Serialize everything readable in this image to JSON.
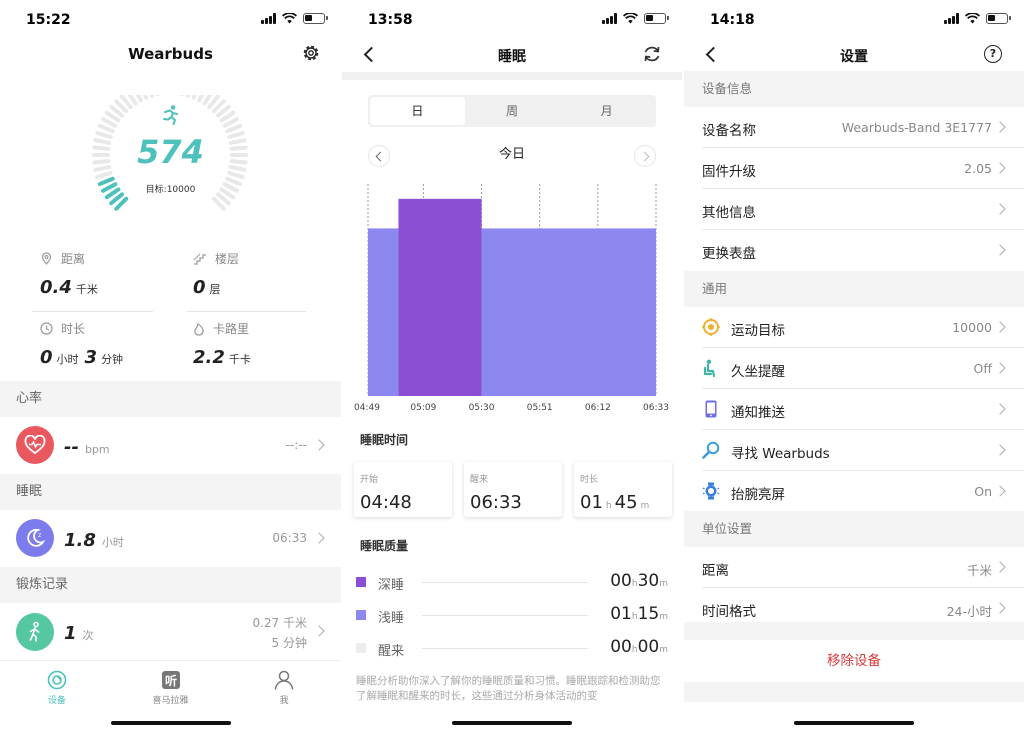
{
  "screen1": {
    "status_time": "15:22",
    "title": "Wearbuds",
    "steps": "574",
    "goal_text": "目标:10000",
    "stats": [
      {
        "icon": "location-pin-icon",
        "label": "距离",
        "value": "0.4",
        "unit": "千米"
      },
      {
        "icon": "stairs-icon",
        "label": "楼层",
        "value": "0",
        "unit": "层"
      },
      {
        "icon": "clock-icon",
        "label": "时长",
        "value1": "0",
        "unit1": "小时",
        "value2": "3",
        "unit2": "分钟"
      },
      {
        "icon": "flame-icon",
        "label": "卡路里",
        "value": "2.2",
        "unit": "千卡"
      }
    ],
    "heart": {
      "section": "心率",
      "value": "--",
      "unit": "bpm",
      "time": "--:--",
      "color": "#e8585e"
    },
    "sleep": {
      "section": "睡眠",
      "value": "1.8",
      "unit": "小时",
      "time": "06:33",
      "color": "#7d7ced"
    },
    "workout": {
      "section": "锻炼记录",
      "value": "1",
      "unit": "次",
      "distance": "0.27 千米",
      "duration": "5 分钟",
      "color": "#56c8a1"
    },
    "tabs": [
      {
        "label": "设备",
        "icon": "device-icon",
        "active": true
      },
      {
        "label": "喜马拉雅",
        "icon": "ximalaya-icon",
        "active": false
      },
      {
        "label": "我",
        "icon": "person-icon",
        "active": false
      }
    ],
    "accent": "#4ec1bc"
  },
  "screen2": {
    "status_time": "13:58",
    "title": "睡眠",
    "segments": [
      "日",
      "周",
      "月"
    ],
    "active_segment": 0,
    "day_label": "今日",
    "section_time": "睡眠时间",
    "cards": [
      {
        "label": "开始",
        "value": "04:48"
      },
      {
        "label": "醒来",
        "value": "06:33"
      },
      {
        "label": "时长",
        "h": "01",
        "h_unit": "h",
        "m": "45",
        "m_unit": "m"
      }
    ],
    "section_quality": "睡眠质量",
    "quality": [
      {
        "name": "深睡",
        "h": "00",
        "m": "30",
        "color": "#8a4fd4"
      },
      {
        "name": "浅睡",
        "h": "01",
        "m": "15",
        "color": "#8c88f0"
      },
      {
        "name": "醒来",
        "h": "00",
        "m": "00",
        "color": "#ececec"
      }
    ],
    "h_unit": "h",
    "m_unit": "m",
    "description": "睡眠分析助你深入了解你的睡眠质量和习惯。睡眠跟踪和检测助您了解睡眠和醒来的时长，这些通过分析身体活动的变",
    "chart_data": {
      "type": "bar",
      "x_ticks": [
        "04:49",
        "05:09",
        "05:30",
        "05:51",
        "06:12",
        "06:33"
      ],
      "x_range": [
        "04:49",
        "06:33"
      ],
      "segments": [
        {
          "stage": "浅睡",
          "start": "04:49",
          "end": "05:00"
        },
        {
          "stage": "深睡",
          "start": "05:00",
          "end": "05:30"
        },
        {
          "stage": "浅睡",
          "start": "05:30",
          "end": "06:33"
        }
      ],
      "stage_levels": {
        "深睡": 1.0,
        "浅睡": 0.85
      },
      "colors": {
        "深睡": "#8a4fd4",
        "浅睡": "#8c88f0"
      },
      "grid": "vertical dashed"
    }
  },
  "screen3": {
    "status_time": "14:18",
    "title": "设置",
    "groups": [
      {
        "header": "设备信息",
        "rows": [
          {
            "label": "设备名称",
            "value": "Wearbuds-Band 3E1777"
          },
          {
            "label": "固件升级",
            "value": "2.05"
          },
          {
            "label": "其他信息",
            "value": ""
          },
          {
            "label": "更换表盘",
            "value": ""
          }
        ]
      },
      {
        "header": "通用",
        "rows": [
          {
            "label": "运动目标",
            "value": "10000",
            "icon": "target-icon"
          },
          {
            "label": "久坐提醒",
            "value": "Off",
            "icon": "sitting-icon"
          },
          {
            "label": "通知推送",
            "value": "",
            "icon": "phone-icon"
          },
          {
            "label": "寻找 Wearbuds",
            "value": "",
            "icon": "magnifier-icon"
          },
          {
            "label": "抬腕亮屏",
            "value": "On",
            "icon": "watch-icon"
          }
        ]
      },
      {
        "header": "单位设置",
        "rows": [
          {
            "label": "距离",
            "value": "千米"
          },
          {
            "label": "时间格式",
            "value": "24-小时"
          }
        ]
      }
    ],
    "remove_label": "移除设备",
    "danger_color": "#d93a3a"
  }
}
